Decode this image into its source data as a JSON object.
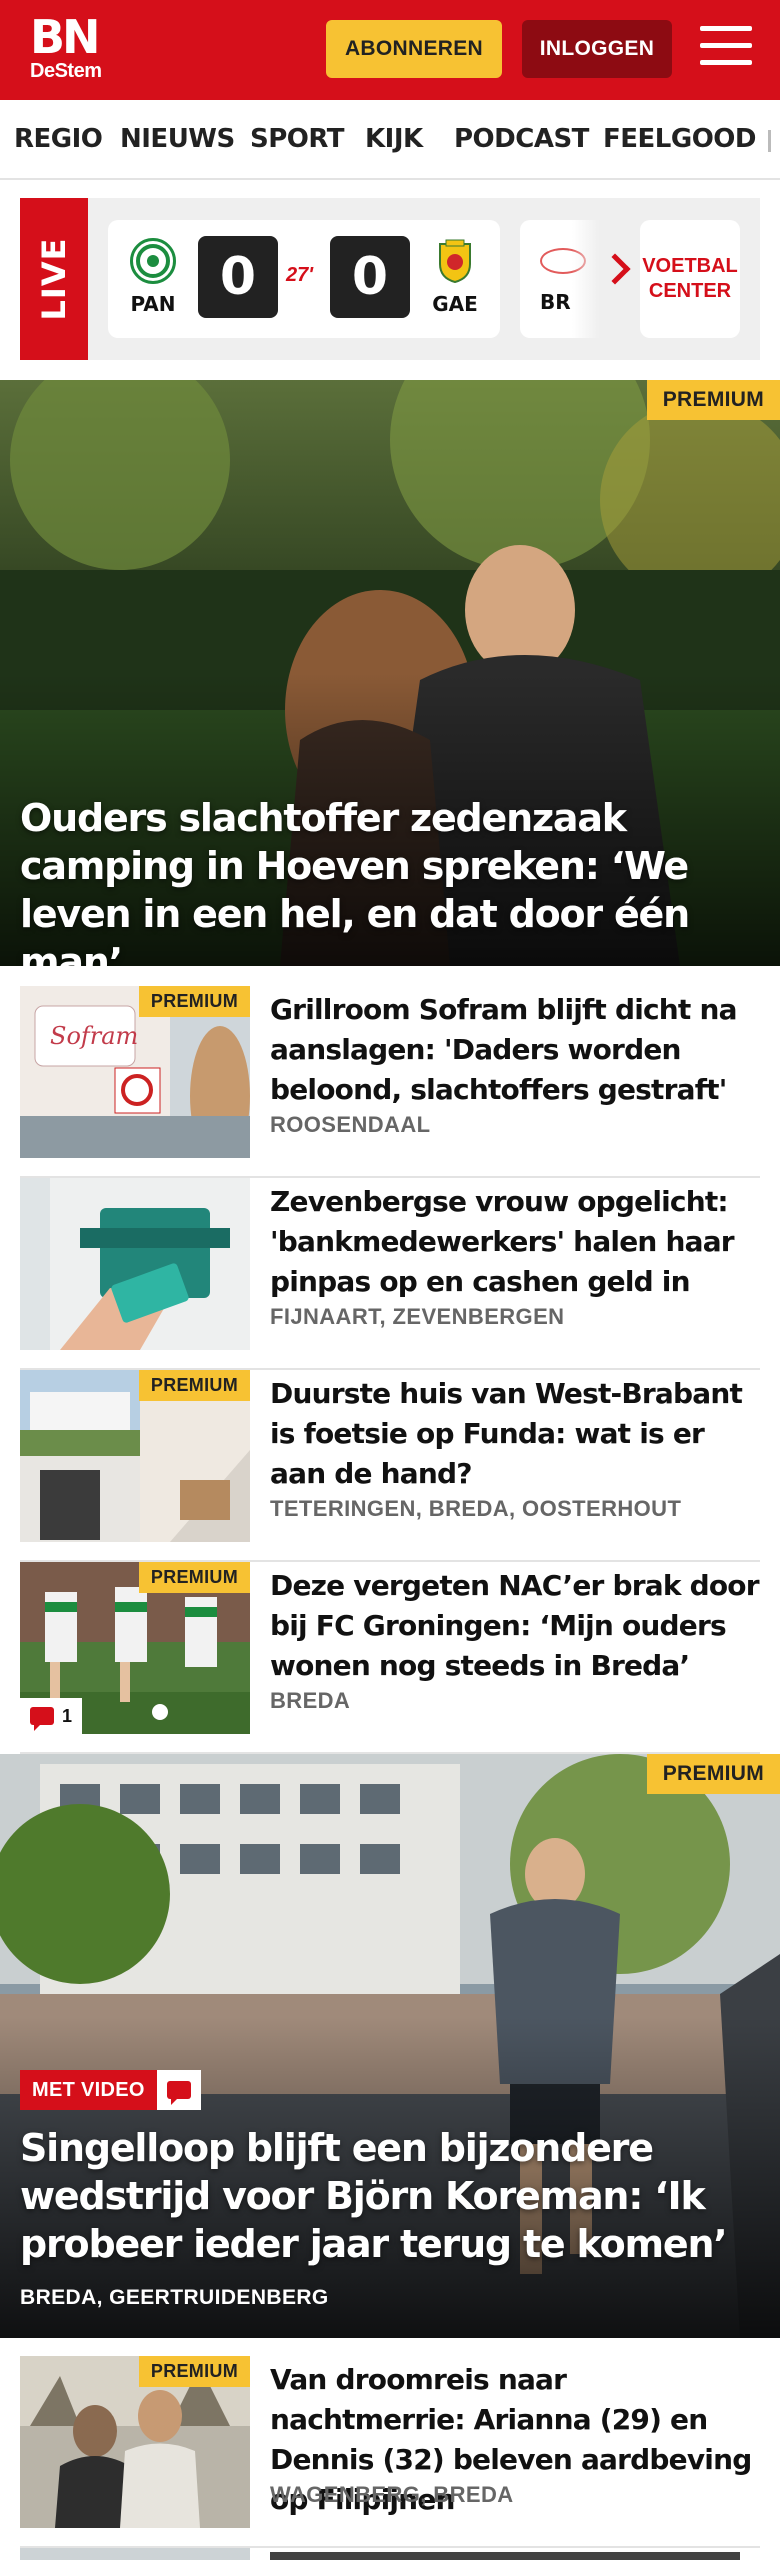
{
  "header": {
    "logo_main": "BN",
    "logo_sub": "DeStem",
    "subscribe_label": "ABONNEREN",
    "login_label": "INLOGGEN"
  },
  "nav": {
    "items": [
      "REGIO",
      "NIEUWS",
      "SPORT",
      "KIJK",
      "PODCAST",
      "FEELGOOD"
    ]
  },
  "live": {
    "label": "LIVE",
    "match": {
      "home": "PAN",
      "away": "GAE",
      "home_score": "0",
      "away_score": "0",
      "minute": "27'"
    },
    "next_match_team": "BR",
    "center_button": "VOETBAL CENTER",
    "colors": {
      "accent": "#d50f1a"
    }
  },
  "hero1": {
    "badge": "PREMIUM",
    "title": "Ouders slachtoffer zedenzaak camping in Hoeven spreken: ‘We leven in een hel, en dat door één man’"
  },
  "articles": [
    {
      "premium": "PREMIUM",
      "title": "Grillroom Sofram blijft dicht na aanslagen: 'Daders worden beloond, slachtoffers gestraft'",
      "tags": "ROOSENDAAL"
    },
    {
      "premium": "",
      "title": "Zevenbergse vrouw opgelicht: 'bankmedewerkers' halen haar pinpas op en cashen geld in hee...",
      "tags": "FIJNAART, ZEVENBERGEN"
    },
    {
      "premium": "PREMIUM",
      "title": "Duurste huis van West-Brabant is foetsie op Funda: wat is er aan de hand?",
      "tags": "TETERINGEN, BREDA, OOSTERHOUT"
    },
    {
      "premium": "PREMIUM",
      "title": "Deze vergeten NAC’er brak door bij FC Groningen: ‘Mijn ouders wonen nog steeds in Breda’",
      "tags": "BREDA",
      "comments": "1"
    }
  ],
  "hero2": {
    "badge": "PREMIUM",
    "video_label": "MET VIDEO",
    "title": "Singelloop blijft een bijzondere wedstrijd voor Björn Koreman: ‘Ik probeer ieder jaar terug te komen’",
    "tags": "BREDA, GEERTRUIDENBERG"
  },
  "article5": {
    "premium": "PREMIUM",
    "title": "Van droomreis naar nachtmerrie: Arianna (29) en Dennis (32) beleven aardbeving op Filipijnen",
    "tags": "WAGENBERG, BREDA"
  },
  "colors": {
    "brand_red": "#d50f1a",
    "premium_yellow": "#f7c233",
    "login_dark_red": "#8d0b12"
  }
}
